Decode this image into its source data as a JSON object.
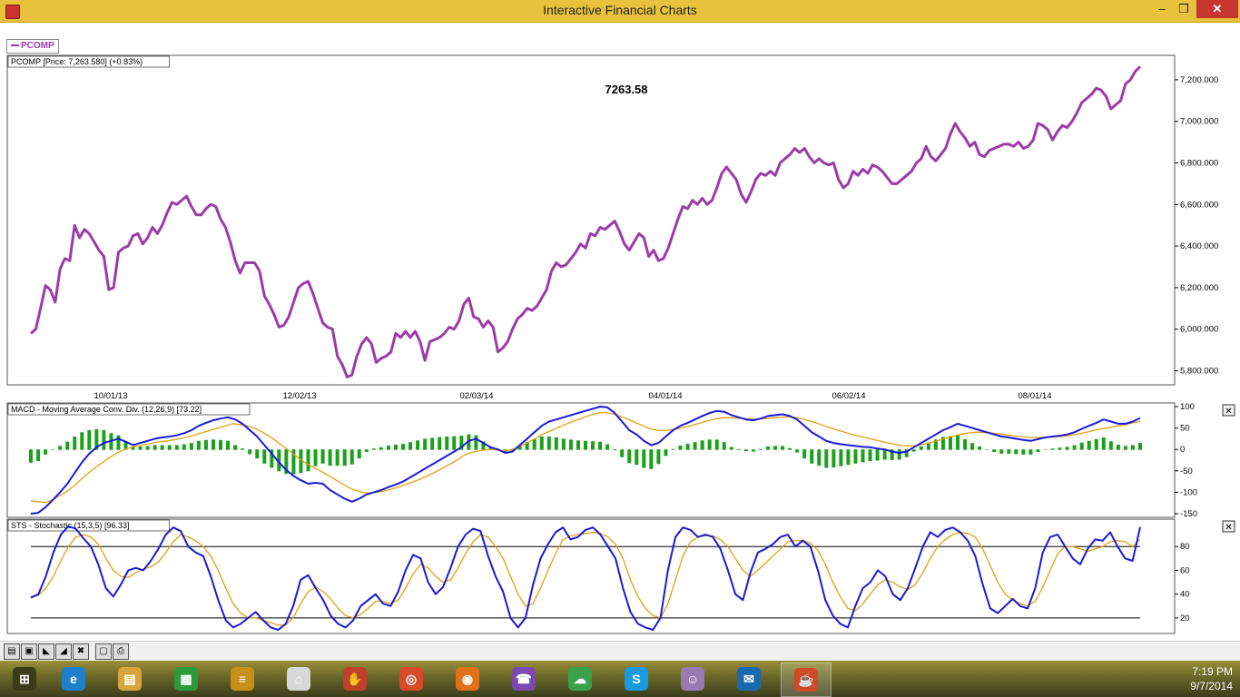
{
  "window": {
    "title": "Interactive Financial Charts",
    "minimize_glyph": "–",
    "maximize_glyph": "❐",
    "close_glyph": "✕"
  },
  "legend": {
    "symbol": "PCOMP"
  },
  "price_panel": {
    "header": "PCOMP [Price: 7,263.580] (+0.83%)",
    "last_value": "7263.58",
    "color": "#9d3aa9",
    "y_ticks": [
      "7,200.000",
      "7,000.000",
      "6,800.000",
      "6,600.000",
      "6,400.000",
      "6,200.000",
      "6,000.000",
      "5,800.000"
    ],
    "x_ticks": [
      "10/01/13",
      "12/02/13",
      "02/03/14",
      "04/01/14",
      "06/02/14",
      "08/01/14"
    ]
  },
  "macd_panel": {
    "header": "MACD - Moving Average Conv. Div. (12,26,9) [73.22]",
    "y_ticks": [
      "100",
      "50",
      "0",
      "-50",
      "-100",
      "-150"
    ],
    "close_glyph": "✕"
  },
  "sto_panel": {
    "header": "STS - Stochastic (15,3,5) [96.33]",
    "y_ticks": [
      "80",
      "60",
      "40",
      "20"
    ],
    "close_glyph": "✕"
  },
  "chart_data": [
    {
      "type": "line",
      "title": "PCOMP [Price: 7,263.580] (+0.83%)",
      "ylim": [
        5750,
        7300
      ],
      "series": [
        {
          "name": "PCOMP",
          "values": [
            5980,
            6000,
            6100,
            6210,
            6190,
            6130,
            6290,
            6340,
            6330,
            6500,
            6440,
            6480,
            6460,
            6420,
            6380,
            6350,
            6190,
            6200,
            6370,
            6390,
            6400,
            6450,
            6460,
            6410,
            6440,
            6490,
            6460,
            6500,
            6560,
            6610,
            6600,
            6620,
            6640,
            6590,
            6550,
            6550,
            6580,
            6600,
            6590,
            6530,
            6490,
            6420,
            6330,
            6270,
            6320,
            6320,
            6320,
            6280,
            6160,
            6120,
            6070,
            6010,
            6020,
            6060,
            6130,
            6200,
            6220,
            6230,
            6170,
            6100,
            6030,
            6010,
            6000,
            5870,
            5830,
            5770,
            5780,
            5870,
            5930,
            5960,
            5930,
            5840,
            5860,
            5870,
            5890,
            5980,
            5960,
            5990,
            5960,
            5990,
            5940,
            5850,
            5940,
            5950,
            5960,
            5980,
            6010,
            6000,
            6040,
            6120,
            6150,
            6060,
            6050,
            6010,
            6040,
            6010,
            5890,
            5910,
            5940,
            6000,
            6050,
            6070,
            6100,
            6090,
            6110,
            6150,
            6190,
            6280,
            6320,
            6300,
            6310,
            6340,
            6370,
            6410,
            6390,
            6460,
            6450,
            6490,
            6480,
            6500,
            6520,
            6470,
            6410,
            6380,
            6420,
            6460,
            6440,
            6350,
            6380,
            6330,
            6340,
            6390,
            6460,
            6530,
            6590,
            6580,
            6620,
            6600,
            6630,
            6600,
            6620,
            6680,
            6750,
            6780,
            6750,
            6720,
            6650,
            6610,
            6660,
            6720,
            6750,
            6740,
            6760,
            6740,
            6800,
            6820,
            6840,
            6870,
            6850,
            6870,
            6830,
            6800,
            6820,
            6800,
            6790,
            6800,
            6720,
            6680,
            6700,
            6760,
            6740,
            6770,
            6750,
            6790,
            6780,
            6760,
            6730,
            6700,
            6700,
            6720,
            6740,
            6760,
            6800,
            6820,
            6880,
            6830,
            6810,
            6840,
            6870,
            6940,
            6990,
            6950,
            6920,
            6880,
            6900,
            6840,
            6830,
            6860,
            6870,
            6880,
            6890,
            6890,
            6880,
            6900,
            6870,
            6880,
            6910,
            6990,
            6980,
            6960,
            6910,
            6950,
            6980,
            6970,
            7000,
            7040,
            7090,
            7110,
            7130,
            7160,
            7150,
            7120,
            7060,
            7080,
            7100,
            7180,
            7200,
            7240,
            7263.58
          ]
        }
      ],
      "x_ticks": [
        "10/01/13",
        "12/02/13",
        "02/03/14",
        "04/01/14",
        "06/02/14",
        "08/01/14"
      ]
    },
    {
      "type": "line",
      "title": "MACD - Moving Average Conv. Div. (12,26,9) [73.22]",
      "ylim": [
        -150,
        100
      ],
      "series": [
        {
          "name": "MACD",
          "color": "#1a1ad6",
          "values": [
            -150,
            -148,
            -135,
            -118,
            -100,
            -80,
            -55,
            -30,
            -10,
            5,
            15,
            20,
            25,
            18,
            10,
            15,
            20,
            25,
            28,
            30,
            33,
            38,
            45,
            55,
            62,
            68,
            72,
            75,
            70,
            60,
            45,
            30,
            10,
            -10,
            -30,
            -48,
            -62,
            -72,
            -80,
            -78,
            -80,
            -95,
            -105,
            -115,
            -122,
            -115,
            -105,
            -100,
            -95,
            -88,
            -82,
            -75,
            -65,
            -55,
            -45,
            -35,
            -25,
            -15,
            -5,
            5,
            20,
            25,
            15,
            5,
            0,
            -8,
            -5,
            10,
            25,
            40,
            55,
            65,
            70,
            75,
            80,
            85,
            90,
            95,
            100,
            98,
            85,
            65,
            45,
            35,
            20,
            10,
            15,
            30,
            45,
            55,
            62,
            70,
            78,
            85,
            90,
            88,
            80,
            75,
            70,
            68,
            72,
            78,
            80,
            82,
            78,
            70,
            55,
            40,
            30,
            20,
            15,
            12,
            10,
            8,
            6,
            5,
            2,
            0,
            -5,
            -8,
            -5,
            5,
            15,
            25,
            35,
            45,
            52,
            60,
            55,
            50,
            45,
            40,
            35,
            30,
            28,
            25,
            22,
            20,
            24,
            28,
            30,
            32,
            35,
            40,
            48,
            55,
            62,
            70,
            65,
            60,
            60,
            65,
            73.22
          ]
        },
        {
          "name": "Signal",
          "color": "#e0a010",
          "values": [
            -120,
            -122,
            -124,
            -118,
            -108,
            -98,
            -85,
            -70,
            -55,
            -42,
            -30,
            -18,
            -8,
            0,
            5,
            8,
            12,
            15,
            18,
            20,
            23,
            26,
            30,
            35,
            40,
            45,
            50,
            55,
            60,
            58,
            55,
            50,
            42,
            32,
            20,
            8,
            -5,
            -18,
            -30,
            -40,
            -48,
            -58,
            -68,
            -78,
            -88,
            -95,
            -100,
            -102,
            -100,
            -97,
            -93,
            -88,
            -82,
            -76,
            -70,
            -62,
            -54,
            -45,
            -36,
            -27,
            -15,
            -8,
            -4,
            -1,
            0,
            -2,
            -3,
            1,
            8,
            16,
            25,
            35,
            42,
            50,
            57,
            64,
            70,
            76,
            82,
            86,
            86,
            82,
            76,
            70,
            62,
            55,
            48,
            44,
            44,
            46,
            49,
            53,
            57,
            62,
            67,
            71,
            74,
            74,
            73,
            72,
            71,
            71,
            72,
            74,
            75,
            76,
            75,
            72,
            67,
            62,
            56,
            50,
            45,
            40,
            35,
            31,
            27,
            23,
            19,
            15,
            12,
            9,
            8,
            9,
            12,
            16,
            21,
            26,
            31,
            35,
            38,
            40,
            40,
            39,
            37,
            35,
            33,
            31,
            29,
            28,
            28,
            28,
            29,
            30,
            32,
            35,
            38,
            42,
            46,
            49,
            52,
            55,
            58,
            62,
            65
          ]
        }
      ]
    },
    {
      "type": "line",
      "title": "STS - Stochastic (15,3,5) [96.33]",
      "ylim": [
        10,
        100
      ],
      "series": [
        {
          "name": "%K",
          "color": "#1a1ad6",
          "values": [
            37,
            40,
            55,
            75,
            90,
            97,
            95,
            87,
            80,
            65,
            45,
            38,
            48,
            60,
            62,
            60,
            68,
            78,
            90,
            96,
            93,
            80,
            75,
            72,
            55,
            35,
            18,
            12,
            15,
            20,
            25,
            18,
            12,
            10,
            15,
            30,
            52,
            56,
            45,
            35,
            22,
            15,
            12,
            18,
            30,
            35,
            40,
            32,
            30,
            42,
            60,
            73,
            70,
            50,
            40,
            46,
            62,
            80,
            90,
            95,
            93,
            72,
            55,
            42,
            20,
            12,
            20,
            48,
            70,
            82,
            92,
            96,
            86,
            88,
            94,
            96,
            90,
            80,
            70,
            45,
            25,
            15,
            12,
            10,
            20,
            60,
            88,
            96,
            94,
            88,
            90,
            88,
            78,
            60,
            40,
            35,
            58,
            75,
            78,
            82,
            88,
            90,
            80,
            85,
            80,
            60,
            35,
            22,
            15,
            12,
            30,
            45,
            50,
            60,
            55,
            40,
            35,
            45,
            62,
            80,
            92,
            88,
            94,
            96,
            92,
            85,
            72,
            48,
            28,
            24,
            30,
            36,
            30,
            28,
            45,
            75,
            88,
            90,
            80,
            70,
            65,
            78,
            86,
            85,
            92,
            80,
            70,
            68,
            96.33
          ]
        },
        {
          "name": "%D",
          "color": "#e0a010",
          "values": [
            38,
            39,
            45,
            55,
            68,
            80,
            88,
            90,
            88,
            82,
            70,
            60,
            55,
            54,
            58,
            61,
            63,
            67,
            75,
            84,
            90,
            88,
            85,
            80,
            72,
            60,
            45,
            32,
            24,
            20,
            20,
            18,
            16,
            14,
            14,
            20,
            32,
            42,
            46,
            42,
            36,
            28,
            22,
            20,
            23,
            28,
            34,
            34,
            32,
            35,
            45,
            57,
            65,
            62,
            55,
            50,
            52,
            62,
            74,
            84,
            90,
            88,
            80,
            70,
            55,
            40,
            30,
            32,
            45,
            60,
            74,
            86,
            89,
            90,
            91,
            92,
            91,
            88,
            82,
            70,
            52,
            38,
            28,
            22,
            20,
            32,
            52,
            72,
            84,
            88,
            89,
            89,
            86,
            80,
            70,
            60,
            55,
            60,
            66,
            72,
            78,
            84,
            85,
            85,
            83,
            77,
            65,
            50,
            38,
            28,
            26,
            32,
            40,
            48,
            52,
            50,
            46,
            44,
            48,
            58,
            70,
            80,
            86,
            90,
            92,
            91,
            88,
            78,
            64,
            50,
            40,
            35,
            32,
            30,
            34,
            46,
            60,
            74,
            80,
            80,
            78,
            76,
            78,
            80,
            84,
            85,
            84,
            80,
            86
          ]
        }
      ],
      "reference_lines": [
        80,
        20
      ]
    }
  ],
  "toolbar": {
    "buttons": [
      {
        "name": "open-button",
        "glyph": "▤"
      },
      {
        "name": "save-button",
        "glyph": "▣"
      },
      {
        "name": "zoom-in-button",
        "glyph": "◣"
      },
      {
        "name": "zoom-out-button",
        "glyph": "◢"
      },
      {
        "name": "reset-button",
        "glyph": "✖"
      },
      {
        "name": "fit-button",
        "glyph": "▢"
      },
      {
        "name": "print-button",
        "glyph": "⎙"
      }
    ]
  },
  "taskbar": {
    "items": [
      {
        "name": "windows-start",
        "glyph": "⊞",
        "color": "#3b3b1a"
      },
      {
        "name": "internet-explorer",
        "glyph": "e",
        "color": "#1e7fcc"
      },
      {
        "name": "file-explorer",
        "glyph": "▤",
        "color": "#d8a53a"
      },
      {
        "name": "store",
        "glyph": "▦",
        "color": "#2a9a3a"
      },
      {
        "name": "notes-app",
        "glyph": "≡",
        "color": "#c8901a"
      },
      {
        "name": "home-app",
        "glyph": "⌂",
        "color": "#d8d8d8"
      },
      {
        "name": "hand-app",
        "glyph": "✋",
        "color": "#c0402a"
      },
      {
        "name": "chrome",
        "glyph": "◎",
        "color": "#d84a2a"
      },
      {
        "name": "firefox",
        "glyph": "◉",
        "color": "#e0701a"
      },
      {
        "name": "viber",
        "glyph": "☎",
        "color": "#7a4ab0"
      },
      {
        "name": "cloud-app",
        "glyph": "☁",
        "color": "#3aa04a"
      },
      {
        "name": "skype",
        "glyph": "S",
        "color": "#1a9ae0"
      },
      {
        "name": "chat-app",
        "glyph": "☺",
        "color": "#9a7ab0"
      },
      {
        "name": "mail-app",
        "glyph": "✉",
        "color": "#1a6ab0"
      },
      {
        "name": "java-app",
        "glyph": "☕",
        "color": "#d04a2a"
      }
    ],
    "time": "7:19 PM",
    "date": "9/7/2014"
  }
}
